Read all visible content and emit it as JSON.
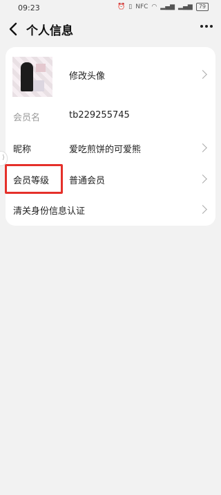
{
  "status": {
    "time": "09:23",
    "icons": [
      "alarm-icon",
      "vibrate-icon",
      "nfc-icon",
      "wifi-icon",
      "signal-icon",
      "signal-icon"
    ],
    "nfc_text": "NFC",
    "battery": "79"
  },
  "header": {
    "title": "个人信息"
  },
  "profile": {
    "avatar_action": "修改头像",
    "member_name_label": "会员名",
    "member_name_value": "tb229255745",
    "nickname_label": "昵称",
    "nickname_value": "爱吃煎饼的可爱熊",
    "level_label": "会员等级",
    "level_value": "普通会员",
    "id_verify_label": "清关身份信息认证"
  },
  "colors": {
    "highlight": "#e5302a",
    "background": "#f2f2f2",
    "card": "#ffffff"
  }
}
